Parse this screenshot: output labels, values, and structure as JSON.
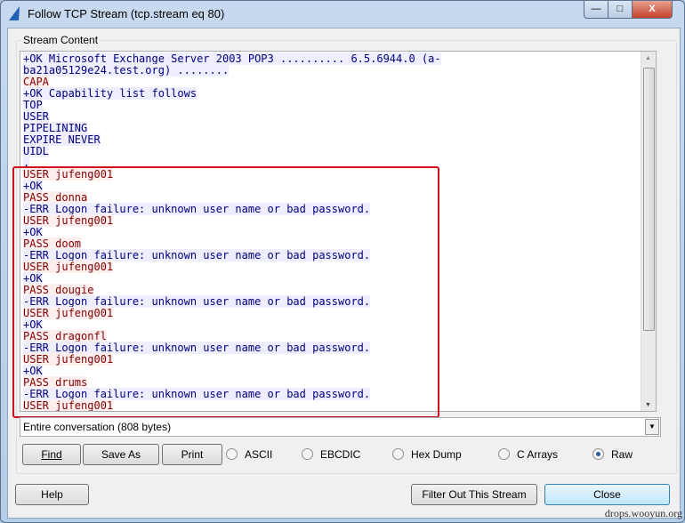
{
  "window": {
    "title": "Follow TCP Stream (tcp.stream eq 80)",
    "minimize": "—",
    "maximize": "□",
    "close": "X"
  },
  "group_label": "Stream Content",
  "lines": [
    {
      "t": "+OK Microsoft Exchange Server 2003 POP3 .......... 6.5.6944.0 (a-",
      "k": "s"
    },
    {
      "t": "ba21a05129e24.test.org) ........",
      "k": "s"
    },
    {
      "t": "CAPA",
      "k": "c"
    },
    {
      "t": "+OK Capability list follows",
      "k": "s"
    },
    {
      "t": "TOP",
      "k": "s"
    },
    {
      "t": "USER",
      "k": "s"
    },
    {
      "t": "PIPELINING",
      "k": "s"
    },
    {
      "t": "EXPIRE NEVER",
      "k": "s"
    },
    {
      "t": "UIDL",
      "k": "s"
    },
    {
      "t": ".",
      "k": "s"
    },
    {
      "t": "USER jufeng001",
      "k": "c"
    },
    {
      "t": "+OK",
      "k": "s"
    },
    {
      "t": "PASS donna",
      "k": "c"
    },
    {
      "t": "-ERR Logon failure: unknown user name or bad password.",
      "k": "s"
    },
    {
      "t": "USER jufeng001",
      "k": "c"
    },
    {
      "t": "+OK",
      "k": "s"
    },
    {
      "t": "PASS doom",
      "k": "c"
    },
    {
      "t": "-ERR Logon failure: unknown user name or bad password.",
      "k": "s"
    },
    {
      "t": "USER jufeng001",
      "k": "c"
    },
    {
      "t": "+OK",
      "k": "s"
    },
    {
      "t": "PASS dougie",
      "k": "c"
    },
    {
      "t": "-ERR Logon failure: unknown user name or bad password.",
      "k": "s"
    },
    {
      "t": "USER jufeng001",
      "k": "c"
    },
    {
      "t": "+OK",
      "k": "s"
    },
    {
      "t": "PASS dragonfl",
      "k": "c"
    },
    {
      "t": "-ERR Logon failure: unknown user name or bad password.",
      "k": "s"
    },
    {
      "t": "USER jufeng001",
      "k": "c"
    },
    {
      "t": "+OK",
      "k": "s"
    },
    {
      "t": "PASS drums",
      "k": "c"
    },
    {
      "t": "-ERR Logon failure: unknown user name or bad password.",
      "k": "s"
    },
    {
      "t": "USER jufeng001",
      "k": "c"
    }
  ],
  "conversation_select": "Entire conversation (808 bytes)",
  "buttons": {
    "find": "Find",
    "save_as": "Save As",
    "print": "Print",
    "help": "Help",
    "filter": "Filter Out This Stream",
    "close": "Close"
  },
  "formats": [
    {
      "label": "ASCII",
      "checked": false
    },
    {
      "label": "EBCDIC",
      "checked": false
    },
    {
      "label": "Hex Dump",
      "checked": false
    },
    {
      "label": "C Arrays",
      "checked": false
    },
    {
      "label": "Raw",
      "checked": true
    }
  ],
  "watermark": "drops.wooyun.org",
  "colors": {
    "client_fg": "#800000",
    "client_bg": "#ffeeee",
    "server_fg": "#000080",
    "server_bg": "#eeeeff",
    "highlight_box": "#d0101c"
  }
}
